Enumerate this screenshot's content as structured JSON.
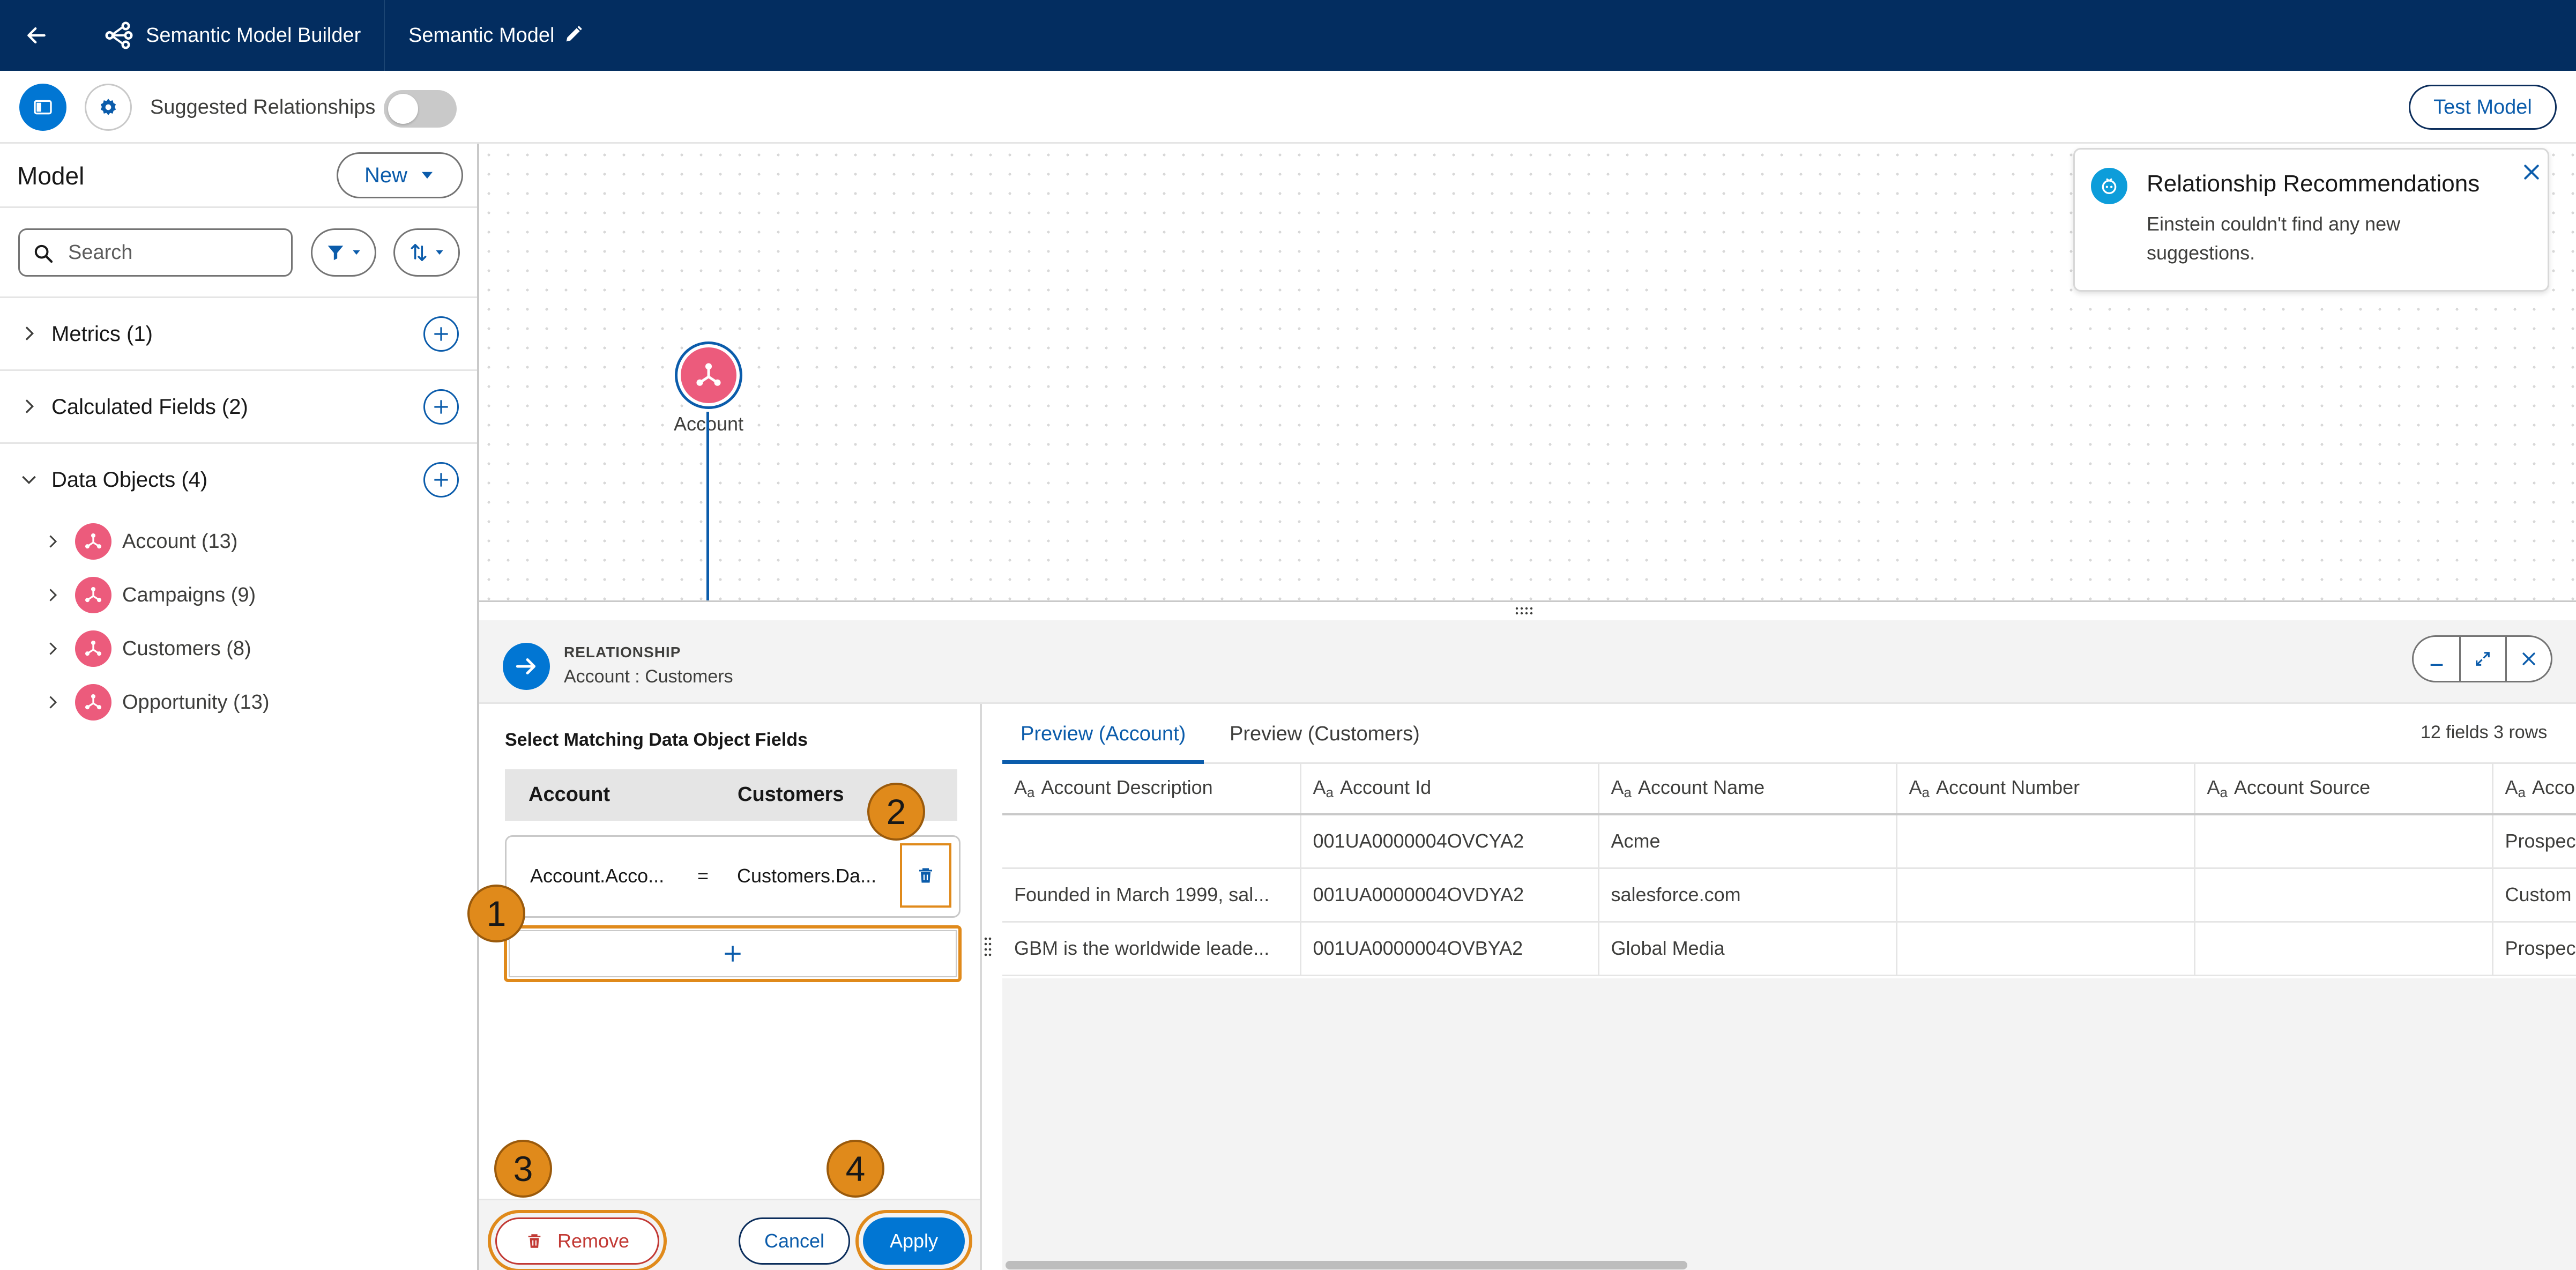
{
  "header": {
    "app_title": "Semantic Model Builder",
    "model_title": "Semantic Model"
  },
  "toolbar": {
    "suggested_label": "Suggested Relationships",
    "suggested_enabled": false,
    "test_model_label": "Test Model"
  },
  "sidebar": {
    "title": "Model",
    "new_label": "New",
    "search_placeholder": "Search",
    "sections": [
      {
        "label": "Metrics (1)",
        "expanded": false
      },
      {
        "label": "Calculated Fields (2)",
        "expanded": false
      },
      {
        "label": "Data Objects (4)",
        "expanded": true
      }
    ],
    "data_objects": [
      {
        "label": "Account (13)"
      },
      {
        "label": "Campaigns (9)"
      },
      {
        "label": "Customers (8)"
      },
      {
        "label": "Opportunity (13)"
      }
    ]
  },
  "canvas": {
    "node_label": "Account"
  },
  "toast": {
    "title": "Relationship Recommendations",
    "body": "Einstein couldn't find any new suggestions."
  },
  "relationship": {
    "kicker": "RELATIONSHIP",
    "name": "Account : Customers",
    "fields_title": "Select Matching Data Object Fields",
    "left_header": "Account",
    "right_header": "Customers",
    "mapping": {
      "left": "Account.Acco...",
      "op": "=",
      "right": "Customers.Da..."
    },
    "remove_label": "Remove",
    "cancel_label": "Cancel",
    "apply_label": "Apply"
  },
  "callouts": [
    "1",
    "2",
    "3",
    "4"
  ],
  "preview": {
    "tabs": [
      "Preview (Account)",
      "Preview (Customers)"
    ],
    "summary": "12 fields 3 rows",
    "columns": [
      "Account Description",
      "Account Id",
      "Account Name",
      "Account Number",
      "Account Source",
      "Acco..."
    ],
    "rows": [
      [
        "",
        "001UA0000004OVCYA2",
        "Acme",
        "",
        "",
        "Prospec"
      ],
      [
        "Founded in March 1999, sal...",
        "001UA0000004OVDYA2",
        "salesforce.com",
        "",
        "",
        "Custom"
      ],
      [
        "GBM is the worldwide leade...",
        "001UA0000004OVBYA2",
        "Global Media",
        "",
        "",
        "Prospec"
      ]
    ]
  },
  "colors": {
    "header_bg": "#032d60",
    "brand_blue": "#0176d3",
    "link_blue": "#0b5cab",
    "object_pink": "#ec5b7c",
    "callout_orange": "#e08a1b",
    "remove_red": "#c23934"
  }
}
